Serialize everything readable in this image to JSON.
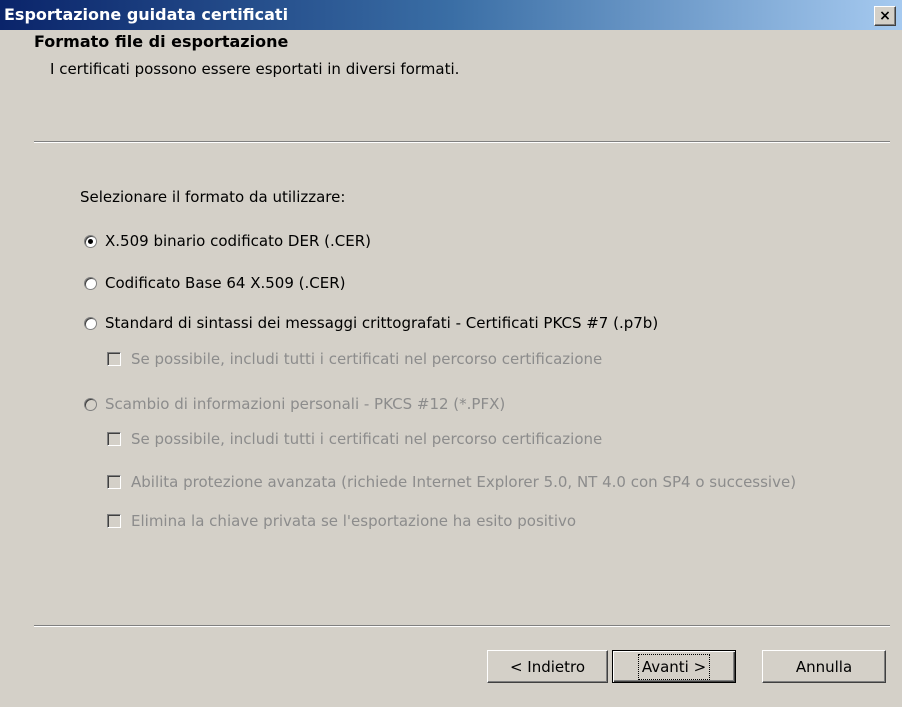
{
  "window": {
    "title": "Esportazione guidata certificati",
    "close_glyph": "×"
  },
  "header": {
    "title": "Formato file di esportazione",
    "subtitle": "I certificati possono essere esportati in diversi formati."
  },
  "body": {
    "prompt": "Selezionare il formato da utilizzare:",
    "options": [
      {
        "label": "X.509 binario codificato DER (.CER)",
        "selected": true,
        "enabled": true
      },
      {
        "label": "Codificato Base 64 X.509 (.CER)",
        "selected": false,
        "enabled": true
      },
      {
        "label": "Standard di sintassi dei messaggi crittografati - Certificati PKCS #7 (.p7b)",
        "selected": false,
        "enabled": true
      },
      {
        "label": "Scambio di informazioni personali - PKCS #12 (*.PFX)",
        "selected": false,
        "enabled": false
      }
    ],
    "pkcs7_include_all": {
      "label": "Se possibile, includi tutti i certificati nel percorso certificazione",
      "checked": false,
      "enabled": false
    },
    "pfx_options": [
      {
        "label": "Se possibile, includi tutti i certificati nel percorso certificazione",
        "checked": false,
        "enabled": false
      },
      {
        "label": "Abilita protezione avanzata (richiede Internet Explorer 5.0, NT 4.0 con SP4 o successive)",
        "checked": false,
        "enabled": false
      },
      {
        "label": "Elimina la chiave privata se l'esportazione ha esito positivo",
        "checked": false,
        "enabled": false
      }
    ]
  },
  "buttons": {
    "back": "< Indietro",
    "next": "Avanti >",
    "cancel": "Annulla"
  },
  "colors": {
    "dialog_bg": "#d4d0c8",
    "titlebar_start": "#0a246a",
    "titlebar_end": "#a6caf0",
    "disabled_text": "#8c8c8c"
  }
}
